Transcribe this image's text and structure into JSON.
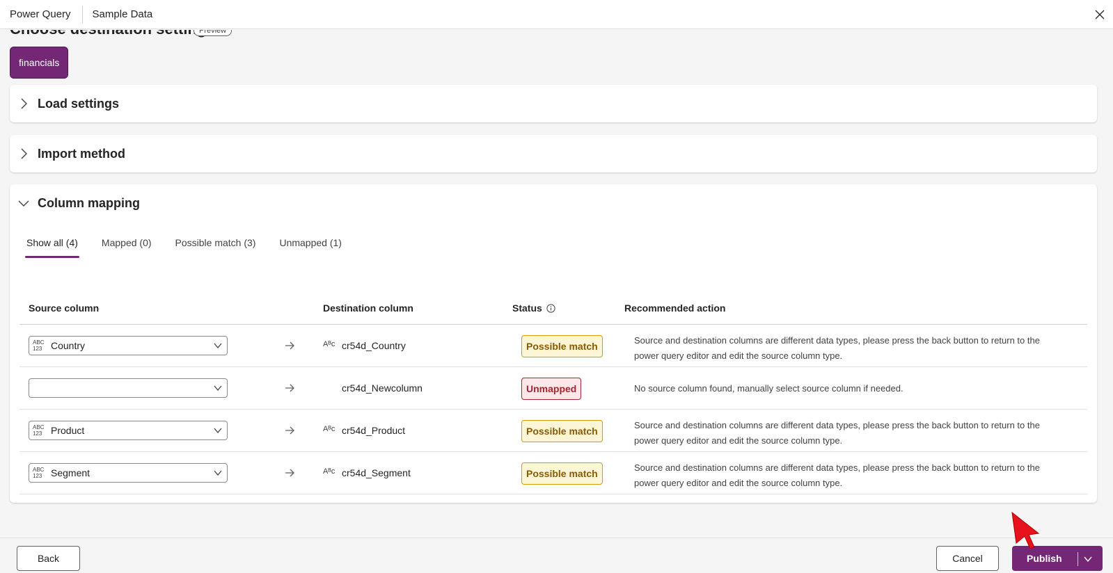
{
  "titlebar": {
    "app": "Power Query",
    "doc": "Sample Data"
  },
  "page": {
    "heading": "Choose destination settings",
    "preview_badge": "Preview"
  },
  "query_chip": "financials",
  "sections": {
    "load_settings": "Load settings",
    "import_method": "Import method",
    "column_mapping": "Column mapping"
  },
  "tabs": [
    {
      "label": "Show all (4)",
      "active": true
    },
    {
      "label": "Mapped (0)",
      "active": false
    },
    {
      "label": "Possible match (3)",
      "active": false
    },
    {
      "label": "Unmapped (1)",
      "active": false
    }
  ],
  "table": {
    "headers": {
      "source": "Source column",
      "destination": "Destination column",
      "status": "Status",
      "action": "Recommended action"
    },
    "type_icon": {
      "top": "ABC",
      "bottom": "123"
    },
    "dest_type_icon": "Aᴮc",
    "rows": [
      {
        "source": "Country",
        "destination": "cr54d_Country",
        "status": "Possible match",
        "status_kind": "possible",
        "action": "Source and destination columns are different data types, please press the back button to return to the power query editor and edit the source column type."
      },
      {
        "source": "",
        "destination": "cr54d_Newcolumn",
        "status": "Unmapped",
        "status_kind": "unmapped",
        "action": "No source column found, manually select source column if needed."
      },
      {
        "source": "Product",
        "destination": "cr54d_Product",
        "status": "Possible match",
        "status_kind": "possible",
        "action": "Source and destination columns are different data types, please press the back button to return to the power query editor and edit the source column type."
      },
      {
        "source": "Segment",
        "destination": "cr54d_Segment",
        "status": "Possible match",
        "status_kind": "possible",
        "action": "Source and destination columns are different data types, please press the back button to return to the power query editor and edit the source column type."
      }
    ]
  },
  "footer": {
    "back": "Back",
    "cancel": "Cancel",
    "publish": "Publish"
  },
  "colors": {
    "accent": "#742774",
    "possible_bg": "#fdf6d6",
    "unmapped_bg": "#fde7e9",
    "cursor": "#e8121c"
  }
}
